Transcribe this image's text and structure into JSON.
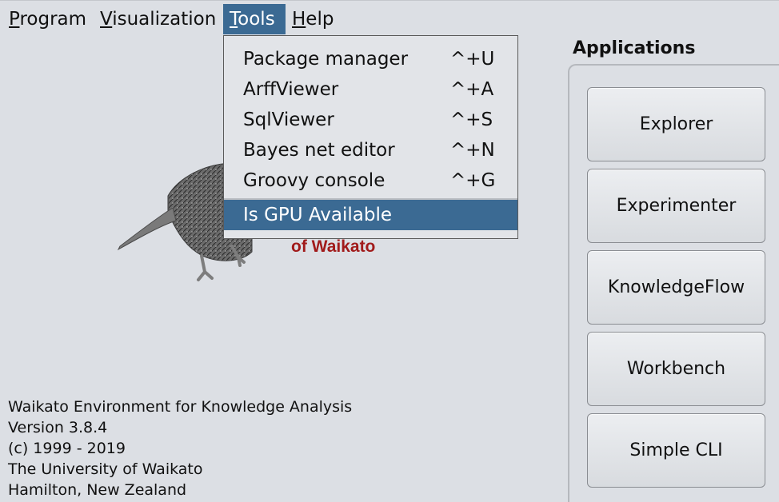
{
  "menubar": {
    "program": {
      "mnemonic": "P",
      "rest": "rogram"
    },
    "visualization": {
      "mnemonic": "V",
      "rest": "isualization"
    },
    "tools": {
      "mnemonic": "T",
      "rest": "ools"
    },
    "help": {
      "mnemonic": "H",
      "rest": "elp"
    }
  },
  "tools_menu": {
    "items": [
      {
        "label": "Package manager",
        "shortcut": "^+U"
      },
      {
        "label": "ArffViewer",
        "shortcut": "^+A"
      },
      {
        "label": "SqlViewer",
        "shortcut": "^+S"
      },
      {
        "label": "Bayes net editor",
        "shortcut": "^+N"
      },
      {
        "label": "Groovy console",
        "shortcut": "^+G"
      }
    ],
    "highlighted": "Is GPU Available"
  },
  "logo": {
    "text": "of Waikato"
  },
  "info": {
    "line1": "Waikato Environment for Knowledge Analysis",
    "line2": "Version 3.8.4",
    "line3": "(c) 1999 - 2019",
    "line4": "The University of Waikato",
    "line5": "Hamilton, New Zealand"
  },
  "applications": {
    "title": "Applications",
    "buttons": [
      "Explorer",
      "Experimenter",
      "KnowledgeFlow",
      "Workbench",
      "Simple CLI"
    ]
  },
  "colors": {
    "background": "#dcdfe4",
    "selection": "#3b6a93",
    "logo_text": "#a11b1b"
  }
}
